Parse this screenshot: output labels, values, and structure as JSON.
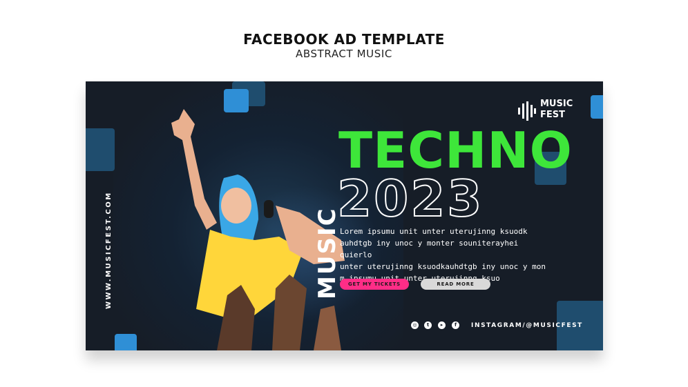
{
  "header": {
    "title": "FACEBOOK AD TEMPLATE",
    "subtitle": "ABSTRACT MUSIC"
  },
  "ad": {
    "side_url": "WWW.MUSICFEST.COM",
    "logo": {
      "line1": "MUSIC",
      "line2": "FEST",
      "icon": "equalizer-bars-icon"
    },
    "vertical_word": "MUSIC",
    "headline": "TECHNO",
    "year": "2023",
    "body_lines": [
      "Lorem ipsumu unit unter uterujinng ksuodk",
      "auhdtgb iny unoc y monter souniterayhei quierlo",
      "unter uterujinng ksuodkauhdtgb iny unoc y mon",
      "m ipsumu unit unter uterujinng ksuo"
    ],
    "buttons": {
      "tickets": "GET MY TICKETS",
      "more": "READ MORE"
    },
    "socials": [
      "instagram-icon",
      "twitter-icon",
      "youtube-icon",
      "facebook-icon"
    ],
    "handle": "INSTAGRAM/@MUSICFEST"
  },
  "colors": {
    "background": "#161d27",
    "accent_green": "#3ee63a",
    "accent_pink": "#ff2d87",
    "tile_blue": "#2f8fd6",
    "tile_dark_blue": "#1f4d6e"
  }
}
